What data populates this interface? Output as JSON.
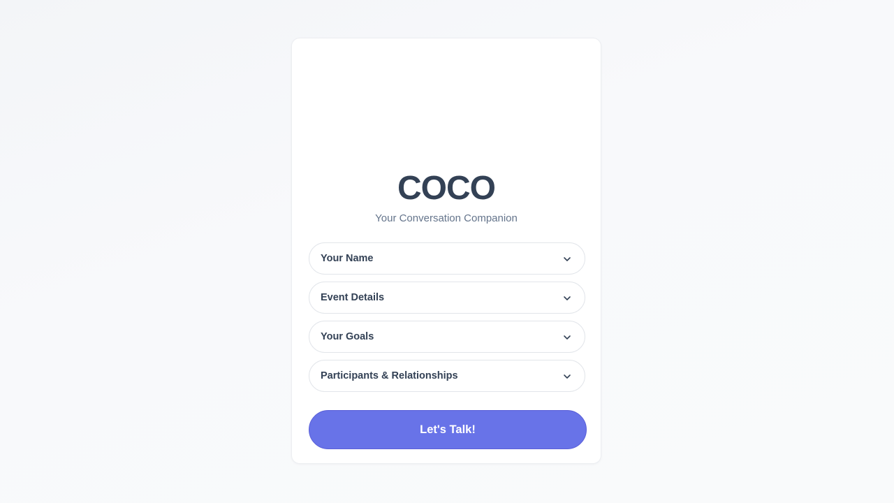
{
  "app": {
    "title": "COCO",
    "subtitle": "Your Conversation Companion"
  },
  "form": {
    "sections": [
      {
        "label": "Your Name",
        "icon": "chevron-down-icon"
      },
      {
        "label": "Event Details",
        "icon": "chevron-down-icon"
      },
      {
        "label": "Your Goals",
        "icon": "chevron-down-icon"
      },
      {
        "label": "Participants & Relationships",
        "icon": "chevron-down-icon"
      }
    ],
    "submit_label": "Let's Talk!"
  },
  "colors": {
    "accent": "#6873e8",
    "title": "#334155",
    "subtitle": "#64748b"
  }
}
